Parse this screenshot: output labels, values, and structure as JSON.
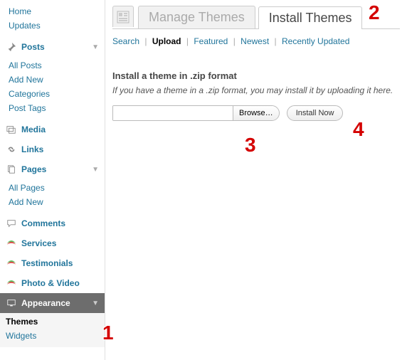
{
  "sidebar": {
    "home": "Home",
    "updates": "Updates",
    "posts": {
      "label": "Posts",
      "items": [
        "All Posts",
        "Add New",
        "Categories",
        "Post Tags"
      ]
    },
    "media": "Media",
    "links": "Links",
    "pages": {
      "label": "Pages",
      "items": [
        "All Pages",
        "Add New"
      ]
    },
    "comments": "Comments",
    "services": "Services",
    "testimonials": "Testimonials",
    "photovideo": "Photo & Video",
    "appearance": {
      "label": "Appearance",
      "items": [
        "Themes",
        "Widgets"
      ]
    }
  },
  "tabs": {
    "manage": "Manage Themes",
    "install": "Install Themes"
  },
  "subnav": {
    "search": "Search",
    "upload": "Upload",
    "featured": "Featured",
    "newest": "Newest",
    "recent": "Recently Updated"
  },
  "upload": {
    "heading": "Install a theme in .zip format",
    "hint": "If you have a theme in a .zip format, you may install it by uploading it here.",
    "browse": "Browse…",
    "install": "Install Now",
    "path": ""
  },
  "callouts": {
    "c1": "1",
    "c2": "2",
    "c3": "3",
    "c4": "4"
  }
}
